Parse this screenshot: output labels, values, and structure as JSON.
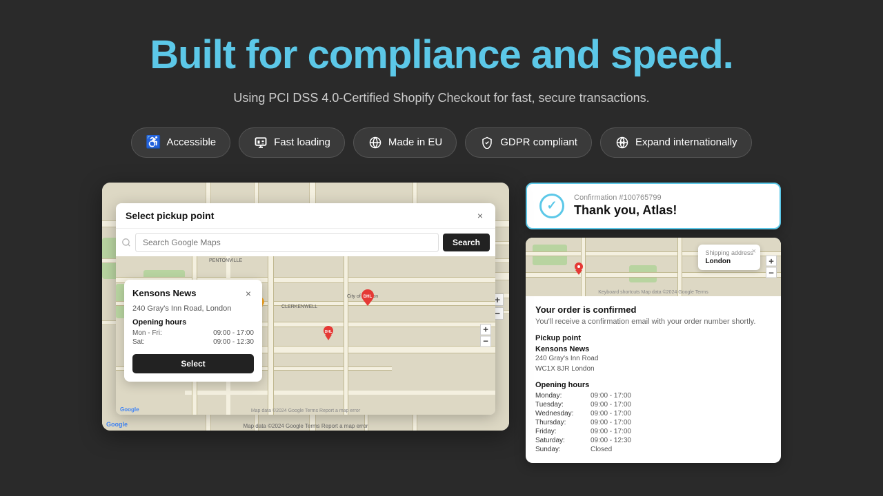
{
  "page": {
    "bg_color": "#2a2a2a"
  },
  "hero": {
    "title": "Built for compliance and speed.",
    "subtitle": "Using PCI DSS 4.0-Certified Shopify Checkout for fast, secure transactions."
  },
  "badges": [
    {
      "id": "accessible",
      "label": "Accessible",
      "icon": "♿"
    },
    {
      "id": "fast-loading",
      "label": "Fast loading",
      "icon": "⚡"
    },
    {
      "id": "made-in-eu",
      "label": "Made in EU",
      "icon": "🌐"
    },
    {
      "id": "gdpr-compliant",
      "label": "GDPR compliant",
      "icon": "🛡"
    },
    {
      "id": "expand-internationally",
      "label": "Expand internationally",
      "icon": "🌍"
    }
  ],
  "pickup_modal": {
    "title": "Select pickup point",
    "search_placeholder": "Search Google Maps",
    "search_button": "Search",
    "store_name": "Kensons News",
    "store_address": "240 Gray's Inn Road, London",
    "hours_title": "Opening hours",
    "hours": [
      {
        "day": "Mon - Fri:",
        "time": "09:00 - 17:00"
      },
      {
        "day": "Sat:",
        "time": "09:00 - 12:30"
      }
    ],
    "select_button": "Select",
    "close_label": "×"
  },
  "confirmation": {
    "order_number": "Confirmation #100765799",
    "thank_you": "Thank you, Atlas!",
    "order_confirmed_title": "Your order is confirmed",
    "order_confirmed_sub": "You'll receive a confirmation email with your order number shortly.",
    "pickup_point_label": "Pickup point",
    "store_name": "Kensons News",
    "store_address_1": "240 Gray's Inn Road",
    "store_address_2": "WC1X 8JR London",
    "opening_hours_label": "Opening hours",
    "hours": [
      {
        "day": "Monday:",
        "time": "09:00 - 17:00"
      },
      {
        "day": "Tuesday:",
        "time": "09:00 - 17:00"
      },
      {
        "day": "Wednesday:",
        "time": "09:00 - 17:00"
      },
      {
        "day": "Thursday:",
        "time": "09:00 - 17:00"
      },
      {
        "day": "Friday:",
        "time": "09:00 - 17:00"
      },
      {
        "day": "Saturday:",
        "time": "09:00 - 12:30"
      },
      {
        "day": "Sunday:",
        "time": "Closed"
      }
    ],
    "shipping_popup_title": "Shipping address",
    "shipping_popup_value": "London",
    "zoom_plus": "+",
    "zoom_minus": "−"
  }
}
